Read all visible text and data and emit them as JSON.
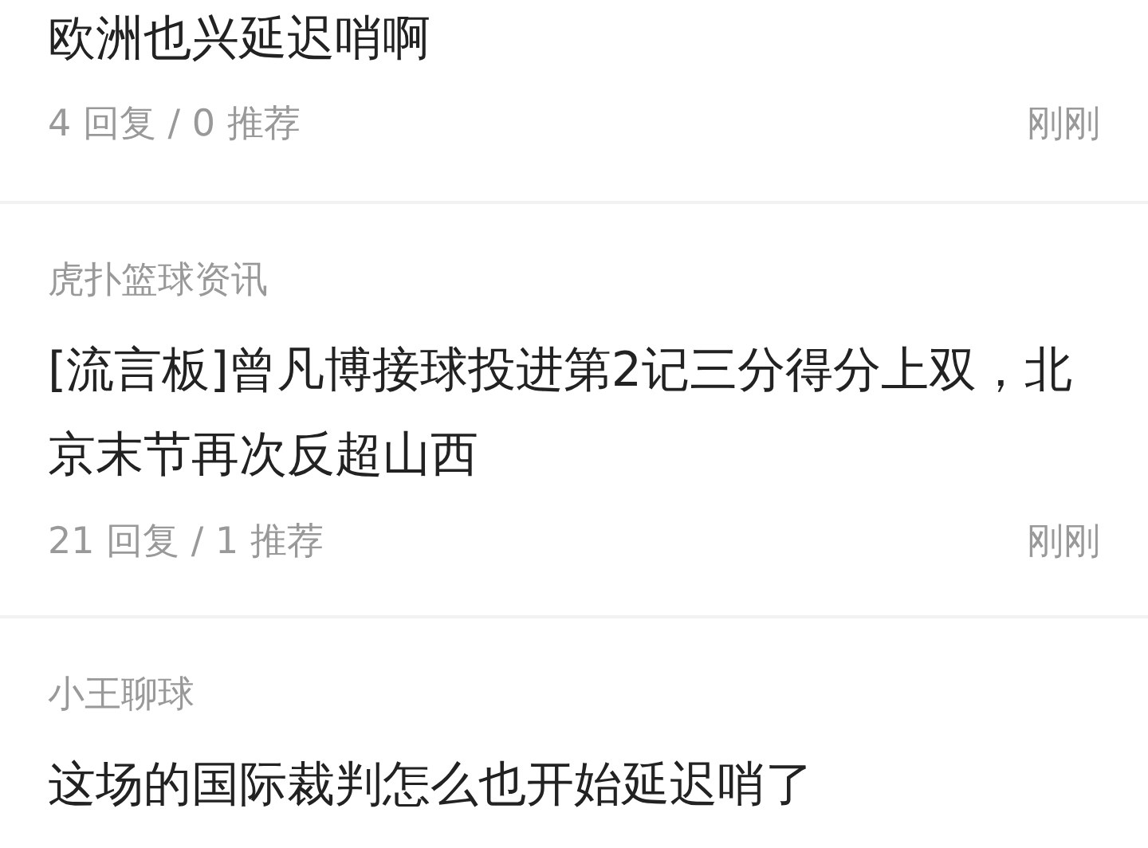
{
  "posts": [
    {
      "title": "欧洲也兴延迟哨啊",
      "replies": "4 回复 / 0 推荐",
      "time": "刚刚"
    },
    {
      "source": "虎扑篮球资讯",
      "title": "[流言板]曾凡博接球投进第2记三分得分上双，北京末节再次反超山西",
      "replies": "21 回复 / 1 推荐",
      "time": "刚刚"
    },
    {
      "source": "小王聊球",
      "title": "这场的国际裁判怎么也开始延迟哨了"
    }
  ]
}
